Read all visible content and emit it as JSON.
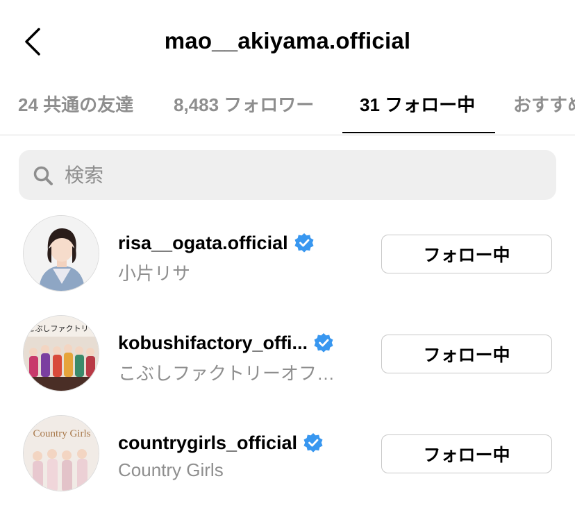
{
  "header": {
    "title": "mao__akiyama.official",
    "back_icon": "chevron-left-icon"
  },
  "tabs": [
    {
      "label": "24 共通の友達",
      "active": false
    },
    {
      "label": "8,483 フォロワー",
      "active": false
    },
    {
      "label": "31 フォロー中",
      "active": true
    },
    {
      "label": "おすすめ",
      "active": false
    }
  ],
  "search": {
    "placeholder": "検索",
    "icon": "search-icon"
  },
  "following": [
    {
      "username": "risa__ogata.official",
      "display_name": "小片リサ",
      "verified": true,
      "button_label": "フォロー中"
    },
    {
      "username": "kobushifactory_offi...",
      "display_name": "こぶしファクトリーオフ…",
      "verified": true,
      "button_label": "フォロー中",
      "avatar_logo_text": "こぶしファクトリー"
    },
    {
      "username": "countrygirls_official",
      "display_name": "Country Girls",
      "verified": true,
      "button_label": "フォロー中",
      "avatar_logo_text": "Country Girls"
    }
  ],
  "colors": {
    "verified": "#3897f0",
    "secondary_text": "#8e8e8e",
    "search_bg": "#efefef",
    "divider": "#dbdbdb"
  }
}
